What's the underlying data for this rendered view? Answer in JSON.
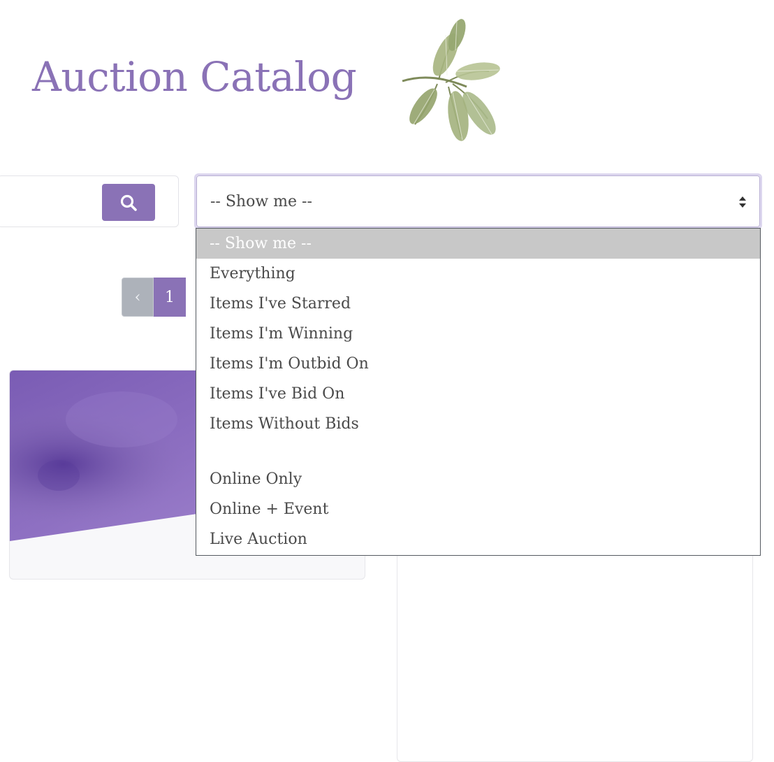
{
  "header": {
    "title": "Auction Catalog"
  },
  "search": {
    "button_icon": "search-icon"
  },
  "filter": {
    "selected": "-- Show me --",
    "options": [
      "-- Show me --",
      "Everything",
      "Items I've Starred",
      "Items I'm Winning",
      "Items I'm Outbid On",
      "Items I've Bid On",
      "Items Without Bids",
      "",
      "Online Only",
      "Online + Event",
      "Live Auction"
    ]
  },
  "pagination": {
    "prev_icon": "chevron-left-icon",
    "prev_symbol": "‹",
    "current_page": "1"
  },
  "colors": {
    "accent": "#8a72b6",
    "selected_option_bg": "#c8c8c8",
    "pager_prev_bg": "#adb2ba"
  }
}
